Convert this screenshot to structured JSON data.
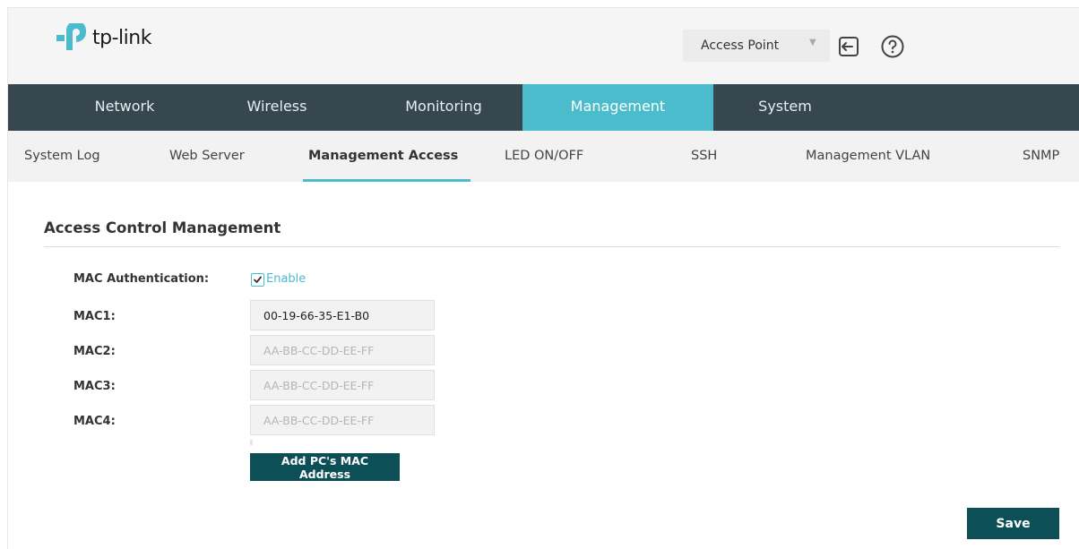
{
  "header": {
    "logo_text": "tp-link",
    "mode_select": {
      "value": "Access Point"
    },
    "colors": {
      "brand": "#4bbccc",
      "nav_bg": "#37474f",
      "button_bg": "#0d4f57"
    }
  },
  "nav": {
    "items": [
      {
        "label": "Network"
      },
      {
        "label": "Wireless"
      },
      {
        "label": "Monitoring"
      },
      {
        "label": "Management",
        "active": true
      },
      {
        "label": "System"
      }
    ]
  },
  "subnav": {
    "items": [
      {
        "label": "System Log"
      },
      {
        "label": "Web Server"
      },
      {
        "label": "Management Access",
        "active": true
      },
      {
        "label": "LED ON/OFF"
      },
      {
        "label": "SSH"
      },
      {
        "label": "Management VLAN"
      },
      {
        "label": "SNMP"
      }
    ]
  },
  "section": {
    "title": "Access Control Management"
  },
  "form": {
    "mac_auth": {
      "label": "MAC Authentication:",
      "checkbox_label": "Enable",
      "checked": true
    },
    "macs": [
      {
        "label": "MAC1:",
        "value": "00-19-66-35-E1-B0",
        "placeholder": "AA-BB-CC-DD-EE-FF"
      },
      {
        "label": "MAC2:",
        "value": "",
        "placeholder": "AA-BB-CC-DD-EE-FF"
      },
      {
        "label": "MAC3:",
        "value": "",
        "placeholder": "AA-BB-CC-DD-EE-FF"
      },
      {
        "label": "MAC4:",
        "value": "",
        "placeholder": "AA-BB-CC-DD-EE-FF"
      }
    ],
    "add_mac_button": "Add PC's MAC Address"
  },
  "footer": {
    "save_label": "Save"
  },
  "icons": {
    "logout": "logout-icon",
    "help": "help-icon",
    "check": "check-icon",
    "caret": "chevron-down-icon"
  }
}
